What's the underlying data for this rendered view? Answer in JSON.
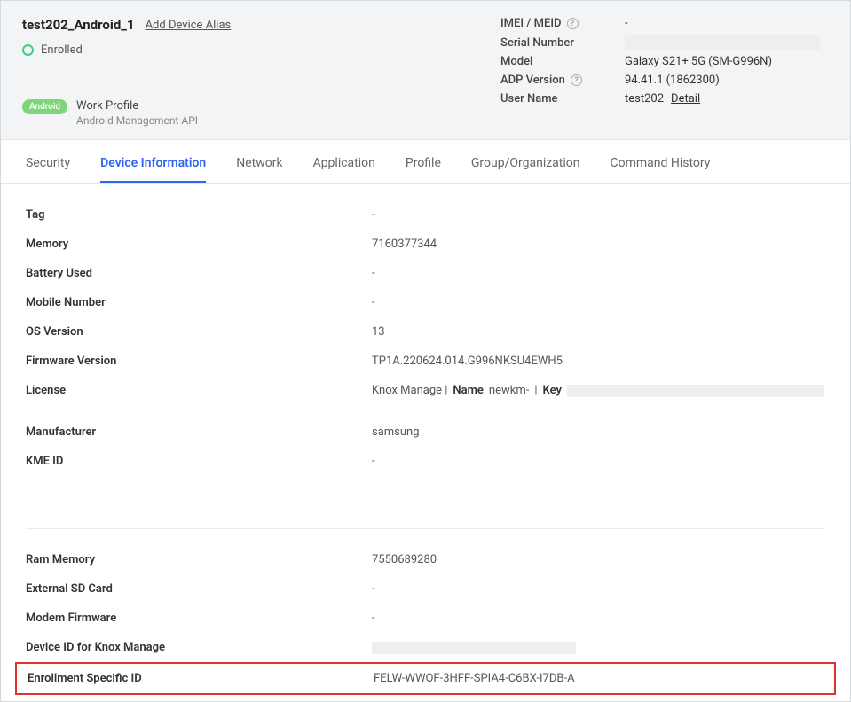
{
  "header": {
    "title": "test202_Android_1",
    "alias_link": "Add Device Alias",
    "status": "Enrolled",
    "badge": "Android",
    "profile_main": "Work Profile",
    "profile_sub": "Android Management API",
    "props": {
      "imei_label": "IMEI / MEID",
      "imei_value": "-",
      "serial_label": "Serial Number",
      "model_label": "Model",
      "model_value": "Galaxy S21+ 5G (SM-G996N)",
      "adp_label": "ADP Version",
      "adp_value": "94.41.1 (1862300)",
      "user_label": "User Name",
      "user_value": "test202",
      "detail_link": "Detail"
    }
  },
  "tabs": [
    {
      "label": "Security"
    },
    {
      "label": "Device Information"
    },
    {
      "label": "Network"
    },
    {
      "label": "Application"
    },
    {
      "label": "Profile"
    },
    {
      "label": "Group/Organization"
    },
    {
      "label": "Command History"
    }
  ],
  "section1": [
    {
      "label": "Tag",
      "value": "-"
    },
    {
      "label": "Memory",
      "value": "7160377344"
    },
    {
      "label": "Battery Used",
      "value": "-"
    },
    {
      "label": "Mobile Number",
      "value": "-"
    },
    {
      "label": "OS Version",
      "value": "13"
    },
    {
      "label": "Firmware Version",
      "value": "TP1A.220624.014.G996NKSU4EWH5"
    }
  ],
  "license": {
    "label": "License",
    "prefix": "Knox Manage  |",
    "name_label": "Name",
    "name_value": "newkm-",
    "key_label": "Key"
  },
  "section1b": [
    {
      "label": "Manufacturer",
      "value": "samsung"
    },
    {
      "label": "KME ID",
      "value": "-"
    }
  ],
  "section2": [
    {
      "label": "Ram Memory",
      "value": "7550689280"
    },
    {
      "label": "External SD Card",
      "value": "-"
    },
    {
      "label": "Modem Firmware",
      "value": "-"
    }
  ],
  "device_id": {
    "label": "Device ID for Knox Manage"
  },
  "enrollment": {
    "label": "Enrollment Specific ID",
    "value": "FELW-WWOF-3HFF-SPIA4-C6BX-I7DB-A"
  }
}
